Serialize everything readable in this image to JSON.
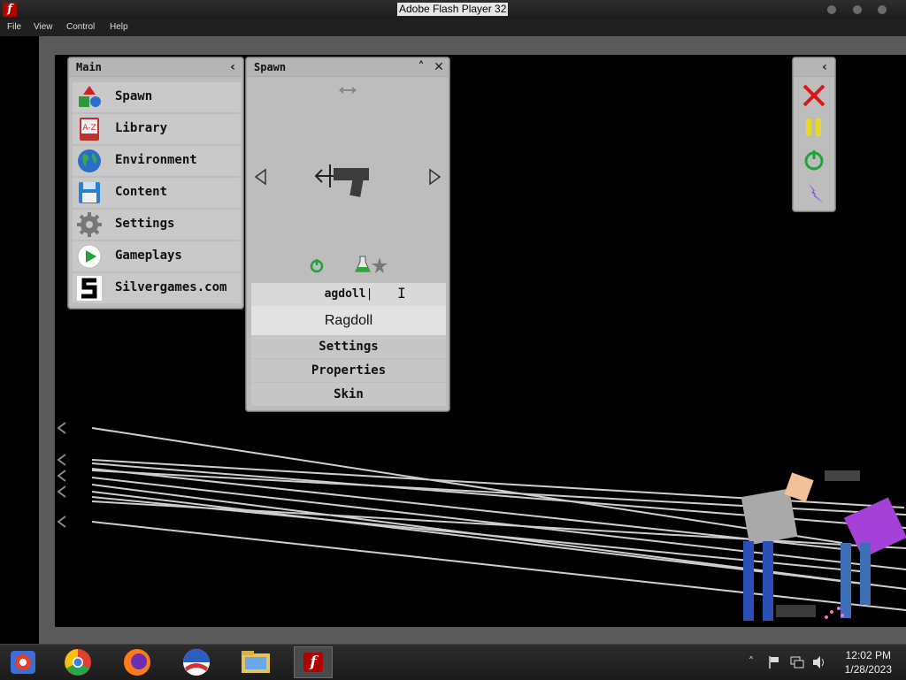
{
  "window": {
    "title": "Adobe Flash Player 32"
  },
  "menu": [
    "File",
    "View",
    "Control",
    "Help"
  ],
  "main_panel": {
    "title": "Main",
    "items": [
      {
        "label": "Spawn",
        "icon": "shapes-icon"
      },
      {
        "label": "Library",
        "icon": "book-a-z-icon"
      },
      {
        "label": "Environment",
        "icon": "globe-icon"
      },
      {
        "label": "Content",
        "icon": "floppy-disk-icon"
      },
      {
        "label": "Settings",
        "icon": "gear-icon"
      },
      {
        "label": "Gameplays",
        "icon": "play-icon"
      },
      {
        "label": "Silvergames.com",
        "icon": "silvergames-logo-icon"
      }
    ]
  },
  "spawn_panel": {
    "title": "Spawn",
    "search_value": "agdoll",
    "suggestion": "Ragdoll",
    "rows": [
      "Settings",
      "Properties",
      "Skin"
    ]
  },
  "control_panel": {
    "buttons": [
      "close-x-icon",
      "pause-icon",
      "power-icon",
      "lightning-icon"
    ]
  },
  "colors": {
    "panel_bg": "#bdbdbd",
    "close_red": "#d81818",
    "pause_yellow": "#e8d62a",
    "power_green": "#1fa33a",
    "lightning_purple": "#8a4fe0"
  },
  "clock": {
    "time": "12:02 PM",
    "date": "1/28/2023"
  }
}
